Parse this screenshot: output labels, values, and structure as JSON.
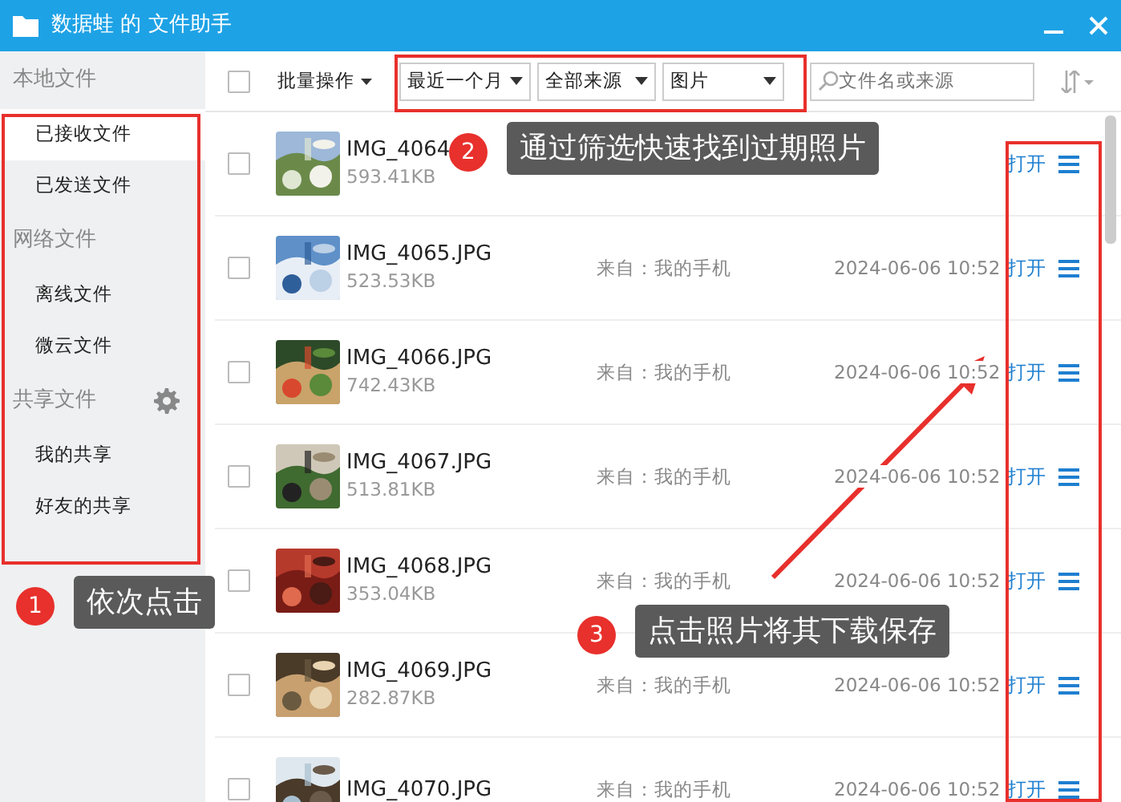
{
  "window": {
    "title": "数据蛙 的 文件助手"
  },
  "sidebar": {
    "sections": [
      {
        "title": "本地文件",
        "settings": false,
        "items": [
          {
            "label": "已接收文件",
            "selected": true
          },
          {
            "label": "已发送文件",
            "selected": false
          }
        ]
      },
      {
        "title": "网络文件",
        "settings": false,
        "items": [
          {
            "label": "离线文件",
            "selected": false
          },
          {
            "label": "微云文件",
            "selected": false
          }
        ]
      },
      {
        "title": "共享文件",
        "settings": true,
        "items": [
          {
            "label": "我的共享",
            "selected": false
          },
          {
            "label": "好友的共享",
            "selected": false
          }
        ]
      }
    ]
  },
  "toolbar": {
    "select_all": {
      "checked": false
    },
    "batch": "批量操作",
    "filters": [
      "最近一个月",
      "全部来源",
      "图片"
    ],
    "search": {
      "placeholder": "文件名或来源"
    }
  },
  "files": [
    {
      "name": "IMG_4064",
      "size": "593.41KB",
      "open": "打开",
      "checked": false
    },
    {
      "name": "IMG_4065.JPG",
      "size": "523.53KB",
      "source": "来自：我的手机",
      "date": "2024-06-06 10:52",
      "open": "打开",
      "checked": false
    },
    {
      "name": "IMG_4066.JPG",
      "size": "742.43KB",
      "source": "来自：我的手机",
      "date": "2024-06-06 10:52",
      "open": "打开",
      "checked": false
    },
    {
      "name": "IMG_4067.JPG",
      "size": "513.81KB",
      "source": "来自：我的手机",
      "date": "2024-06-06 10:52",
      "open": "打开",
      "checked": false
    },
    {
      "name": "IMG_4068.JPG",
      "size": "353.04KB",
      "source": "来自：我的手机",
      "date": "2024-06-06 10:52",
      "open": "打开",
      "checked": false
    },
    {
      "name": "IMG_4069.JPG",
      "size": "282.87KB",
      "source": "来自：我的手机",
      "date": "2024-06-06 10:52",
      "open": "打开",
      "checked": false
    },
    {
      "name": "IMG_4070.JPG",
      "source": "来自：我的手机",
      "date": "2024-06-06 10:52",
      "open": "打开",
      "checked": false
    }
  ],
  "annotations": [
    {
      "number": "1",
      "text": "依次点击"
    },
    {
      "number": "2",
      "text": "通过筛选快速找到过期照片"
    },
    {
      "number": "3",
      "text": "点击照片将其下载保存"
    }
  ]
}
